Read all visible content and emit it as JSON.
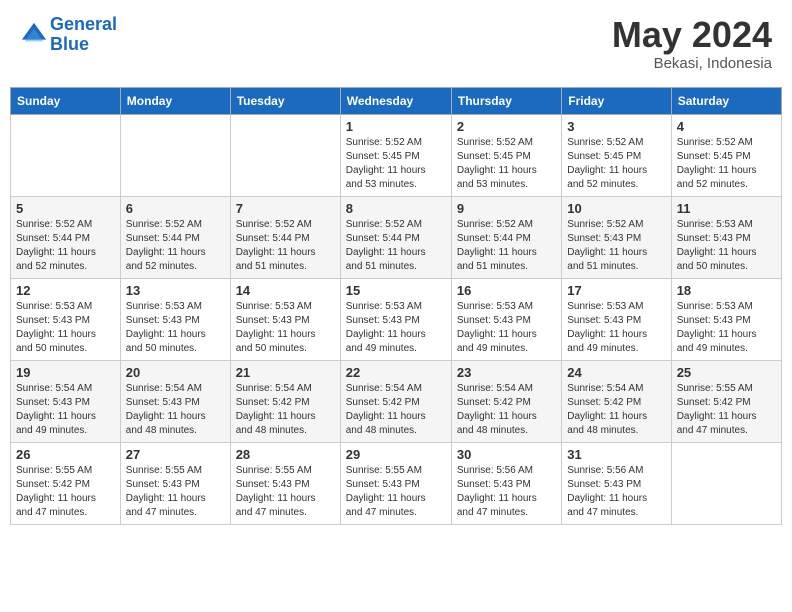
{
  "header": {
    "logo_line1": "General",
    "logo_line2": "Blue",
    "month": "May 2024",
    "location": "Bekasi, Indonesia"
  },
  "days_of_week": [
    "Sunday",
    "Monday",
    "Tuesday",
    "Wednesday",
    "Thursday",
    "Friday",
    "Saturday"
  ],
  "weeks": [
    [
      {
        "day": "",
        "info": ""
      },
      {
        "day": "",
        "info": ""
      },
      {
        "day": "",
        "info": ""
      },
      {
        "day": "1",
        "info": "Sunrise: 5:52 AM\nSunset: 5:45 PM\nDaylight: 11 hours\nand 53 minutes."
      },
      {
        "day": "2",
        "info": "Sunrise: 5:52 AM\nSunset: 5:45 PM\nDaylight: 11 hours\nand 53 minutes."
      },
      {
        "day": "3",
        "info": "Sunrise: 5:52 AM\nSunset: 5:45 PM\nDaylight: 11 hours\nand 52 minutes."
      },
      {
        "day": "4",
        "info": "Sunrise: 5:52 AM\nSunset: 5:45 PM\nDaylight: 11 hours\nand 52 minutes."
      }
    ],
    [
      {
        "day": "5",
        "info": "Sunrise: 5:52 AM\nSunset: 5:44 PM\nDaylight: 11 hours\nand 52 minutes."
      },
      {
        "day": "6",
        "info": "Sunrise: 5:52 AM\nSunset: 5:44 PM\nDaylight: 11 hours\nand 52 minutes."
      },
      {
        "day": "7",
        "info": "Sunrise: 5:52 AM\nSunset: 5:44 PM\nDaylight: 11 hours\nand 51 minutes."
      },
      {
        "day": "8",
        "info": "Sunrise: 5:52 AM\nSunset: 5:44 PM\nDaylight: 11 hours\nand 51 minutes."
      },
      {
        "day": "9",
        "info": "Sunrise: 5:52 AM\nSunset: 5:44 PM\nDaylight: 11 hours\nand 51 minutes."
      },
      {
        "day": "10",
        "info": "Sunrise: 5:52 AM\nSunset: 5:43 PM\nDaylight: 11 hours\nand 51 minutes."
      },
      {
        "day": "11",
        "info": "Sunrise: 5:53 AM\nSunset: 5:43 PM\nDaylight: 11 hours\nand 50 minutes."
      }
    ],
    [
      {
        "day": "12",
        "info": "Sunrise: 5:53 AM\nSunset: 5:43 PM\nDaylight: 11 hours\nand 50 minutes."
      },
      {
        "day": "13",
        "info": "Sunrise: 5:53 AM\nSunset: 5:43 PM\nDaylight: 11 hours\nand 50 minutes."
      },
      {
        "day": "14",
        "info": "Sunrise: 5:53 AM\nSunset: 5:43 PM\nDaylight: 11 hours\nand 50 minutes."
      },
      {
        "day": "15",
        "info": "Sunrise: 5:53 AM\nSunset: 5:43 PM\nDaylight: 11 hours\nand 49 minutes."
      },
      {
        "day": "16",
        "info": "Sunrise: 5:53 AM\nSunset: 5:43 PM\nDaylight: 11 hours\nand 49 minutes."
      },
      {
        "day": "17",
        "info": "Sunrise: 5:53 AM\nSunset: 5:43 PM\nDaylight: 11 hours\nand 49 minutes."
      },
      {
        "day": "18",
        "info": "Sunrise: 5:53 AM\nSunset: 5:43 PM\nDaylight: 11 hours\nand 49 minutes."
      }
    ],
    [
      {
        "day": "19",
        "info": "Sunrise: 5:54 AM\nSunset: 5:43 PM\nDaylight: 11 hours\nand 49 minutes."
      },
      {
        "day": "20",
        "info": "Sunrise: 5:54 AM\nSunset: 5:43 PM\nDaylight: 11 hours\nand 48 minutes."
      },
      {
        "day": "21",
        "info": "Sunrise: 5:54 AM\nSunset: 5:42 PM\nDaylight: 11 hours\nand 48 minutes."
      },
      {
        "day": "22",
        "info": "Sunrise: 5:54 AM\nSunset: 5:42 PM\nDaylight: 11 hours\nand 48 minutes."
      },
      {
        "day": "23",
        "info": "Sunrise: 5:54 AM\nSunset: 5:42 PM\nDaylight: 11 hours\nand 48 minutes."
      },
      {
        "day": "24",
        "info": "Sunrise: 5:54 AM\nSunset: 5:42 PM\nDaylight: 11 hours\nand 48 minutes."
      },
      {
        "day": "25",
        "info": "Sunrise: 5:55 AM\nSunset: 5:42 PM\nDaylight: 11 hours\nand 47 minutes."
      }
    ],
    [
      {
        "day": "26",
        "info": "Sunrise: 5:55 AM\nSunset: 5:42 PM\nDaylight: 11 hours\nand 47 minutes."
      },
      {
        "day": "27",
        "info": "Sunrise: 5:55 AM\nSunset: 5:43 PM\nDaylight: 11 hours\nand 47 minutes."
      },
      {
        "day": "28",
        "info": "Sunrise: 5:55 AM\nSunset: 5:43 PM\nDaylight: 11 hours\nand 47 minutes."
      },
      {
        "day": "29",
        "info": "Sunrise: 5:55 AM\nSunset: 5:43 PM\nDaylight: 11 hours\nand 47 minutes."
      },
      {
        "day": "30",
        "info": "Sunrise: 5:56 AM\nSunset: 5:43 PM\nDaylight: 11 hours\nand 47 minutes."
      },
      {
        "day": "31",
        "info": "Sunrise: 5:56 AM\nSunset: 5:43 PM\nDaylight: 11 hours\nand 47 minutes."
      },
      {
        "day": "",
        "info": ""
      }
    ]
  ]
}
